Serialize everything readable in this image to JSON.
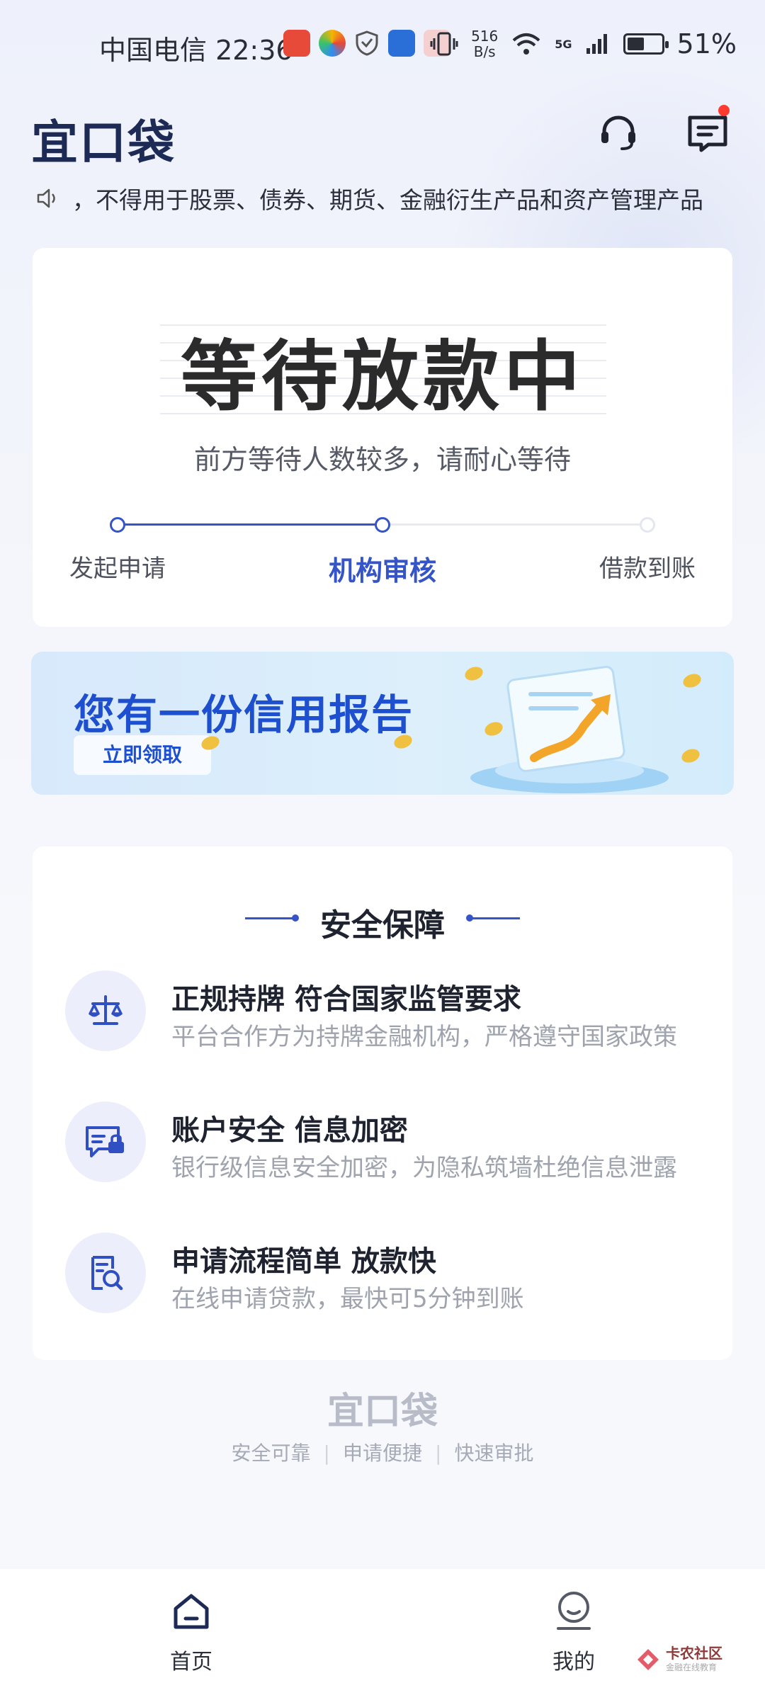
{
  "status_bar": {
    "carrier_time": "中国电信 22:36",
    "net_speed_value": "516",
    "net_speed_unit": "B/s",
    "network": "5G",
    "battery": "51%",
    "battery_level": 0.51
  },
  "header": {
    "logo": "宜口袋"
  },
  "notice": {
    "text": "，不得用于股票、债券、期货、金融衍生产品和资产管理产品"
  },
  "status_card": {
    "title": "等待放款中",
    "subtitle": "前方等待人数较多，请耐心等待",
    "steps": [
      {
        "label": "发起申请",
        "state": "done"
      },
      {
        "label": "机构审核",
        "state": "active"
      },
      {
        "label": "借款到账",
        "state": "todo"
      }
    ]
  },
  "banner": {
    "title": "您有一份信用报告",
    "button": "立即领取"
  },
  "security": {
    "heading": "安全保障",
    "items": [
      {
        "title": "正规持牌 符合国家监管要求",
        "desc": "平台合作方为持牌金融机构，严格遵守国家政策",
        "icon": "scale-icon"
      },
      {
        "title": "账户安全 信息加密",
        "desc": "银行级信息安全加密，为隐私筑墙杜绝信息泄露",
        "icon": "secure-message-icon"
      },
      {
        "title": "申请流程简单 放款快",
        "desc": "在线申请贷款，最快可5分钟到账",
        "icon": "document-search-icon"
      }
    ]
  },
  "footer": {
    "logo": "宜口袋",
    "tags": [
      "安全可靠",
      "申请便捷",
      "快速审批"
    ]
  },
  "bottom_nav": {
    "home": "首页",
    "mine": "我的"
  },
  "watermark": {
    "text": "卡农社区",
    "sub": "金融在线教育"
  },
  "colors": {
    "accent": "#3454c7",
    "brand": "#1c2a55",
    "banner_blue": "#1e4fcf"
  }
}
